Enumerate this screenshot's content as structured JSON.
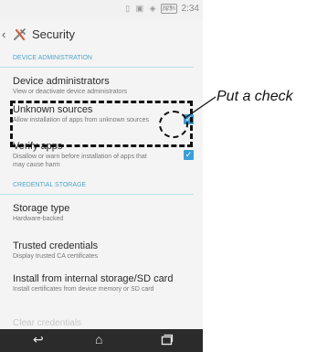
{
  "status_bar": {
    "icons": "▯ ▣ ◈ .ıl",
    "battery": "82%",
    "time": "2:34"
  },
  "action_bar": {
    "back_icon": "chevron-left-icon",
    "app_icon": "settings-gear-icon",
    "title": "Security"
  },
  "sections": [
    {
      "header": "DEVICE ADMINISTRATION",
      "items": [
        {
          "title": "Device administrators",
          "subtitle": "View or deactivate device administrators",
          "checkbox": null
        },
        {
          "title": "Unknown sources",
          "subtitle": "Allow installation of apps from unknown sources",
          "checkbox": true
        },
        {
          "title": "Verify apps",
          "subtitle": "Disallow or warn before installation of apps that may cause harm",
          "checkbox": true
        }
      ]
    },
    {
      "header": "CREDENTIAL STORAGE",
      "items": [
        {
          "title": "Storage type",
          "subtitle": "Hardware-backed",
          "checkbox": null
        },
        {
          "title": "Trusted credentials",
          "subtitle": "Display trusted CA certificates",
          "checkbox": null
        },
        {
          "title": "Install from internal storage/SD card",
          "subtitle": "Install certificates from device memory or SD card",
          "checkbox": null
        },
        {
          "title": "Clear credentials",
          "subtitle": "",
          "checkbox": null
        }
      ]
    }
  ],
  "nav_bar": {
    "back_icon": "back-arrow-icon",
    "home_icon": "home-icon",
    "recents_icon": "recents-icon"
  },
  "annotation": {
    "callout_text": "Put a check"
  },
  "colors": {
    "accent": "#3a9fd8",
    "section_header": "#4ea6c9",
    "nav_bar": "#2b2b2b"
  }
}
